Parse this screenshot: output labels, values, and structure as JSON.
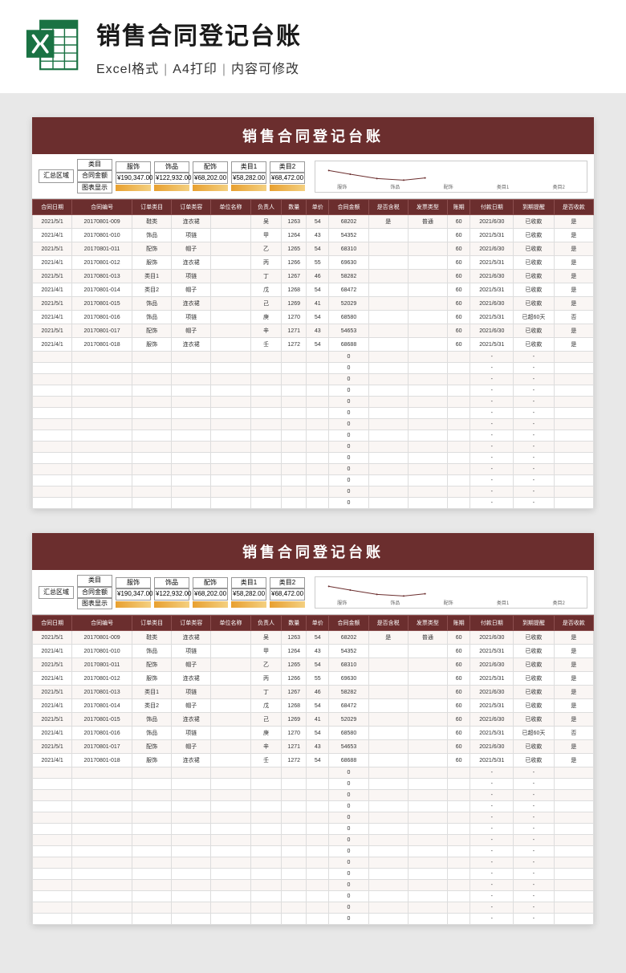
{
  "header": {
    "title": "销售合同登记台账",
    "sub1": "Excel格式",
    "sub2": "A4打印",
    "sub3": "内容可修改"
  },
  "sheet": {
    "title": "销售合同登记台账",
    "summary_label": "汇总区域",
    "summary_rows": [
      "类目",
      "合同金额",
      "图表显示"
    ],
    "summary_cols": [
      {
        "name": "服饰",
        "amount": "¥190,347.00"
      },
      {
        "name": "饰品",
        "amount": "¥122,932.00"
      },
      {
        "name": "配饰",
        "amount": "¥68,202.00"
      },
      {
        "name": "类目1",
        "amount": "¥58,282.00"
      },
      {
        "name": "类目2",
        "amount": "¥68,472.00"
      }
    ],
    "chart_labels": [
      "服饰",
      "饰品",
      "配饰",
      "类目1",
      "类目2"
    ],
    "columns": [
      "合同日期",
      "合同编号",
      "订单类目",
      "订单类容",
      "单位名称",
      "负责人",
      "数量",
      "单价",
      "合同金额",
      "是否含税",
      "发票类型",
      "账期",
      "付款日期",
      "到期提醒",
      "是否收款"
    ],
    "rows": [
      [
        "2021/5/1",
        "20170801-009",
        "鞋类",
        "连衣裙",
        "",
        "吴",
        "1263",
        "54",
        "68202",
        "是",
        "普通",
        "60",
        "2021/6/30",
        "已收款",
        "是"
      ],
      [
        "2021/4/1",
        "20170801-010",
        "饰品",
        "项链",
        "",
        "甲",
        "1264",
        "43",
        "54352",
        "",
        "",
        "60",
        "2021/5/31",
        "已收款",
        "是"
      ],
      [
        "2021/5/1",
        "20170801-011",
        "配饰",
        "帽子",
        "",
        "乙",
        "1265",
        "54",
        "68310",
        "",
        "",
        "60",
        "2021/6/30",
        "已收款",
        "是"
      ],
      [
        "2021/4/1",
        "20170801-012",
        "服饰",
        "连衣裙",
        "",
        "丙",
        "1266",
        "55",
        "69630",
        "",
        "",
        "60",
        "2021/5/31",
        "已收款",
        "是"
      ],
      [
        "2021/5/1",
        "20170801-013",
        "类目1",
        "项链",
        "",
        "丁",
        "1267",
        "46",
        "58282",
        "",
        "",
        "60",
        "2021/6/30",
        "已收款",
        "是"
      ],
      [
        "2021/4/1",
        "20170801-014",
        "类目2",
        "帽子",
        "",
        "戊",
        "1268",
        "54",
        "68472",
        "",
        "",
        "60",
        "2021/5/31",
        "已收款",
        "是"
      ],
      [
        "2021/5/1",
        "20170801-015",
        "饰品",
        "连衣裙",
        "",
        "己",
        "1269",
        "41",
        "52029",
        "",
        "",
        "60",
        "2021/6/30",
        "已收款",
        "是"
      ],
      [
        "2021/4/1",
        "20170801-016",
        "饰品",
        "项链",
        "",
        "庚",
        "1270",
        "54",
        "68580",
        "",
        "",
        "60",
        "2021/5/31",
        "已超60天",
        "否"
      ],
      [
        "2021/5/1",
        "20170801-017",
        "配饰",
        "帽子",
        "",
        "辛",
        "1271",
        "43",
        "54653",
        "",
        "",
        "60",
        "2021/6/30",
        "已收款",
        "是"
      ],
      [
        "2021/4/1",
        "20170801-018",
        "服饰",
        "连衣裙",
        "",
        "壬",
        "1272",
        "54",
        "68688",
        "",
        "",
        "60",
        "2021/5/31",
        "已收款",
        "是"
      ]
    ],
    "empty_rows": 14
  },
  "chart_data": {
    "type": "line",
    "title": "",
    "categories": [
      "服饰",
      "饰品",
      "配饰",
      "类目1",
      "类目2"
    ],
    "values": [
      190347,
      122932,
      68202,
      58282,
      68472
    ],
    "ylim": [
      0,
      200000
    ],
    "xlabel": "",
    "ylabel": ""
  }
}
